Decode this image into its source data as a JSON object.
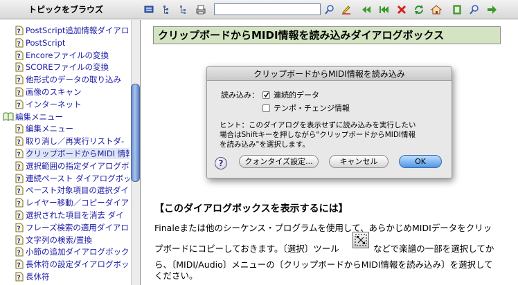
{
  "toolbar": {
    "nav_title": "トピックをブラウズ",
    "search_value": "",
    "icons": [
      "contents-icon",
      "index-icon",
      "glossary-icon",
      "print-icon",
      "search-go-icon",
      "highlight-icon",
      "first-topic-icon",
      "previous-topic-icon",
      "stop-icon",
      "refresh-icon",
      "home-icon",
      "bookmark-icon",
      "find-icon",
      "next-topic-icon"
    ]
  },
  "sidebar": {
    "items": [
      {
        "label": "PostScript追加情報ダイアロ",
        "type": "doc"
      },
      {
        "label": "PostScript",
        "type": "doc"
      },
      {
        "label": "Encoreファイルの変換",
        "type": "doc"
      },
      {
        "label": "SCOREファイルの変換",
        "type": "doc"
      },
      {
        "label": "他形式のデータの取り込み",
        "type": "doc"
      },
      {
        "label": "画像のスキャン",
        "type": "doc"
      },
      {
        "label": "インターネット",
        "type": "doc"
      },
      {
        "label": "編集メニュー",
        "type": "book"
      },
      {
        "label": "編集メニュー",
        "type": "doc"
      },
      {
        "label": "取り消し／再実行リストダ-",
        "type": "doc"
      },
      {
        "label": "クリップボードからMIDI 情報",
        "type": "doc",
        "selected": true
      },
      {
        "label": "選択範囲の指定ダイアログボ",
        "type": "doc"
      },
      {
        "label": "連続ペースト ダイアログボッ",
        "type": "doc"
      },
      {
        "label": "ペースト対象項目の選択ダイ",
        "type": "doc"
      },
      {
        "label": "レイヤー移動／コピーダイア",
        "type": "doc"
      },
      {
        "label": "選択された項目を消去 ダイ",
        "type": "doc"
      },
      {
        "label": "フレーズ検索の適用ダイアロ",
        "type": "doc"
      },
      {
        "label": "文字列の検索/置換",
        "type": "doc"
      },
      {
        "label": "小節の追加ダイアログボック",
        "type": "doc"
      },
      {
        "label": "長休符の設定ダイアログボッ",
        "type": "doc"
      },
      {
        "label": "長休符",
        "type": "doc"
      }
    ]
  },
  "main": {
    "title": "クリップボードからMIDI情報を読み込みダイアログボックス",
    "dialog": {
      "title": "クリップボードからMIDI情報を読み込み",
      "read_label": "読み込み：",
      "check_continuous": "連続的データ",
      "check_tempo": "テンポ・チェンジ情報",
      "hint_line1": "ヒント：このダイアログを表示せずに読み込みを実行したい",
      "hint_line2": "場合はShiftキーを押しながら\"クリップボードからMIDI情報",
      "hint_line3": "を読み込み\"を選択します。",
      "help": "?",
      "quantize_btn": "クォンタイズ設定...",
      "cancel_btn": "キャンセル",
      "ok_btn": "OK"
    },
    "section_heading": "【このダイアログボックスを表示するには】",
    "line1": "Finaleまたは他のシーケンス・プログラムを使用して、あらかじめMIDIデータをクリッ",
    "line2a": "プボードにコピーしておきます。〔選択〕ツール",
    "line2b": "などで楽譜の一部を選択してか",
    "line3": "ら、〔MIDI/Audio〕メニューの〔クリップボードからMIDI情報を読み込み〕を選択して",
    "line4": "ください。"
  }
}
